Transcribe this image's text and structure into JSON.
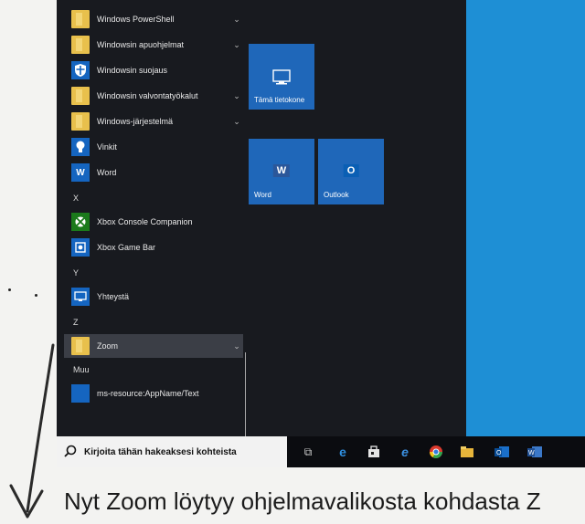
{
  "start_menu": {
    "apps": [
      {
        "label": "Windows PowerShell",
        "icon": "folder-icon",
        "chevron": true
      },
      {
        "label": "Windowsin apuohjelmat",
        "icon": "folder-icon",
        "chevron": true
      },
      {
        "label": "Windowsin suojaus",
        "icon": "shield-icon",
        "chevron": false
      },
      {
        "label": "Windowsin valvontatyökalut",
        "icon": "folder-icon",
        "chevron": true
      },
      {
        "label": "Windows-järjestelmä",
        "icon": "folder-icon",
        "chevron": true
      },
      {
        "label": "Vinkit",
        "icon": "lightbulb-icon",
        "chevron": false
      },
      {
        "label": "Word",
        "icon": "word-icon",
        "chevron": false
      }
    ],
    "section_x": "X",
    "x_apps": [
      {
        "label": "Xbox Console Companion",
        "icon": "xbox-icon"
      },
      {
        "label": "Xbox Game Bar",
        "icon": "xbox-game-bar-icon"
      }
    ],
    "section_y": "Y",
    "y_apps": [
      {
        "label": "Yhteystä",
        "icon": "connect-icon"
      }
    ],
    "section_z": "Z",
    "z_apps": [
      {
        "label": "Zoom",
        "icon": "folder-icon",
        "chevron": true,
        "selected": true
      }
    ],
    "section_other": "Muu",
    "other_apps": [
      {
        "label": "ms-resource:AppName/Text",
        "icon": "blank-app-icon"
      }
    ]
  },
  "tiles": [
    {
      "label": "Tämä tietokone",
      "icon": "computer-icon"
    },
    {
      "label": "Word",
      "icon": "word-icon"
    },
    {
      "label": "Outlook",
      "icon": "outlook-icon"
    }
  ],
  "taskbar": {
    "search_placeholder": "Kirjoita tähän hakeaksesi kohteista",
    "icons": [
      "task-view-icon",
      "edge-icon",
      "store-icon",
      "internet-explorer-icon",
      "chrome-icon",
      "file-explorer-icon",
      "outlook-icon",
      "word-icon"
    ]
  },
  "caption": "Nyt Zoom löytyy ohjelmavalikosta kohdasta Z",
  "colors": {
    "accent_tile": "#1f67b9",
    "desktop": "#1e8fd5",
    "folder": "#e8c04c"
  }
}
